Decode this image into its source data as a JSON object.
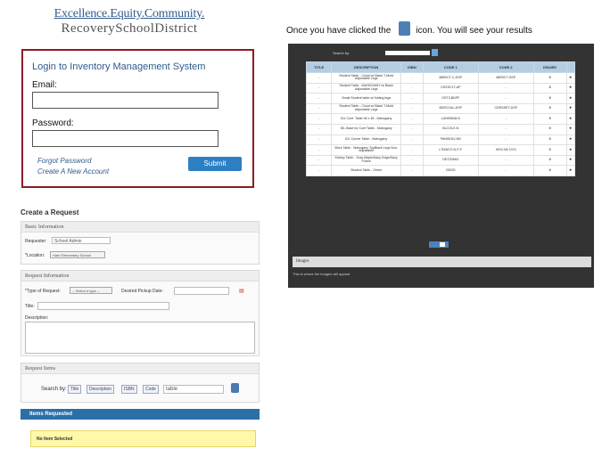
{
  "logo": {
    "line1": "Excellence.Equity.Community.",
    "line2": "RecoverySchoolDistrict"
  },
  "login": {
    "title": "Login to Inventory Management System",
    "email_label": "Email:",
    "password_label": "Password:",
    "forgot_link": "Forgot Password",
    "create_link": "Create A New Account",
    "submit_label": "Submit"
  },
  "request": {
    "title": "Create a Request",
    "basic": {
      "header": "Basic Information",
      "requester_label": "Requester:",
      "requester_value": "School Admin",
      "location_label": "*Location:",
      "location_value": "Hale Elementary School"
    },
    "info": {
      "header": "Request Information",
      "type_label": "*Type of Request:",
      "type_value": "-- Select a type --",
      "pickup_label": "Desired Pickup Date:",
      "title_label": "Title:",
      "description_label": "Description:"
    },
    "items": {
      "header": "Request Items",
      "search_label": "Search by:",
      "sort_buttons": [
        "Title",
        "Description",
        "ISBN",
        "Code"
      ],
      "search_value": "table"
    },
    "requested": {
      "header": "Items Requested",
      "empty_text": "No Item Selected"
    }
  },
  "caption": {
    "before": "Once you have clicked the",
    "after": "icon.  You will see your results",
    "icon": "search-icon"
  },
  "results": {
    "search_label": "Search by:",
    "columns": [
      "TITLE",
      "DESCRIPTION",
      "ISBN",
      "CODE 1",
      "CODE 2",
      "ISSUED",
      ""
    ],
    "rows": [
      {
        "title": "-",
        "desc": "Student Table - Cloud w/ Black T-Mold Adjustable Legs",
        "isbn": "-",
        "code1": "88R0CT-C-DSP",
        "code2": "88R0CT-DSP",
        "issued": "0"
      },
      {
        "title": "-",
        "desc": "Student Table - MAHOGANY w/ Black Adjustable Legs",
        "isbn": "-",
        "code1": "CDSSC1T-AP",
        "code2": "-",
        "issued": "0"
      },
      {
        "title": "-",
        "desc": "Small Student table w/ folding legs",
        "isbn": "-",
        "code1": "GST3-BDPF",
        "code2": "-",
        "issued": "0"
      },
      {
        "title": "-",
        "desc": "Student Table - Cloud w/ Black T-Mold Adjustable Legs",
        "isbn": "-",
        "code1": "8DRCOAL-DSP",
        "code2": "CDRSSET-DSP",
        "issued": "0"
      },
      {
        "title": "-",
        "desc": "IDL Conf. Table 96 x 48 - Mahogany",
        "isbn": "-",
        "code1": "LANS9648-N",
        "code2": "-",
        "issued": "0"
      },
      {
        "title": "-",
        "desc": "IDL Base for Conf Table - Mahogany",
        "isbn": "-",
        "code1": "BLCOLE-N",
        "code2": "-",
        "issued": "0"
      },
      {
        "title": "-",
        "desc": "IDL Corner Table - Mahogany",
        "isbn": "-",
        "code1": "PANSKKV-NN",
        "code2": "-",
        "issued": "0"
      },
      {
        "title": "-",
        "desc": "Work Table - Mahogany TopBlack Legs Non-Adjustable",
        "isbn": "-",
        "code1": "LTM3672-N-P-F",
        "code2": "WSV-N6 1074",
        "issued": "0"
      },
      {
        "title": "-",
        "desc": "Kidney Table - Gray Maple/Navy Edge/Navy Frame",
        "isbn": "-",
        "code1": "HDT3348G",
        "code2": "-",
        "issued": "0"
      },
      {
        "title": "-",
        "desc": "Student Table - Green",
        "isbn": "-",
        "code1": "2503G",
        "code2": "-",
        "issued": "0"
      }
    ],
    "images_header": "Images",
    "images_text": "This is where the images will appear"
  }
}
